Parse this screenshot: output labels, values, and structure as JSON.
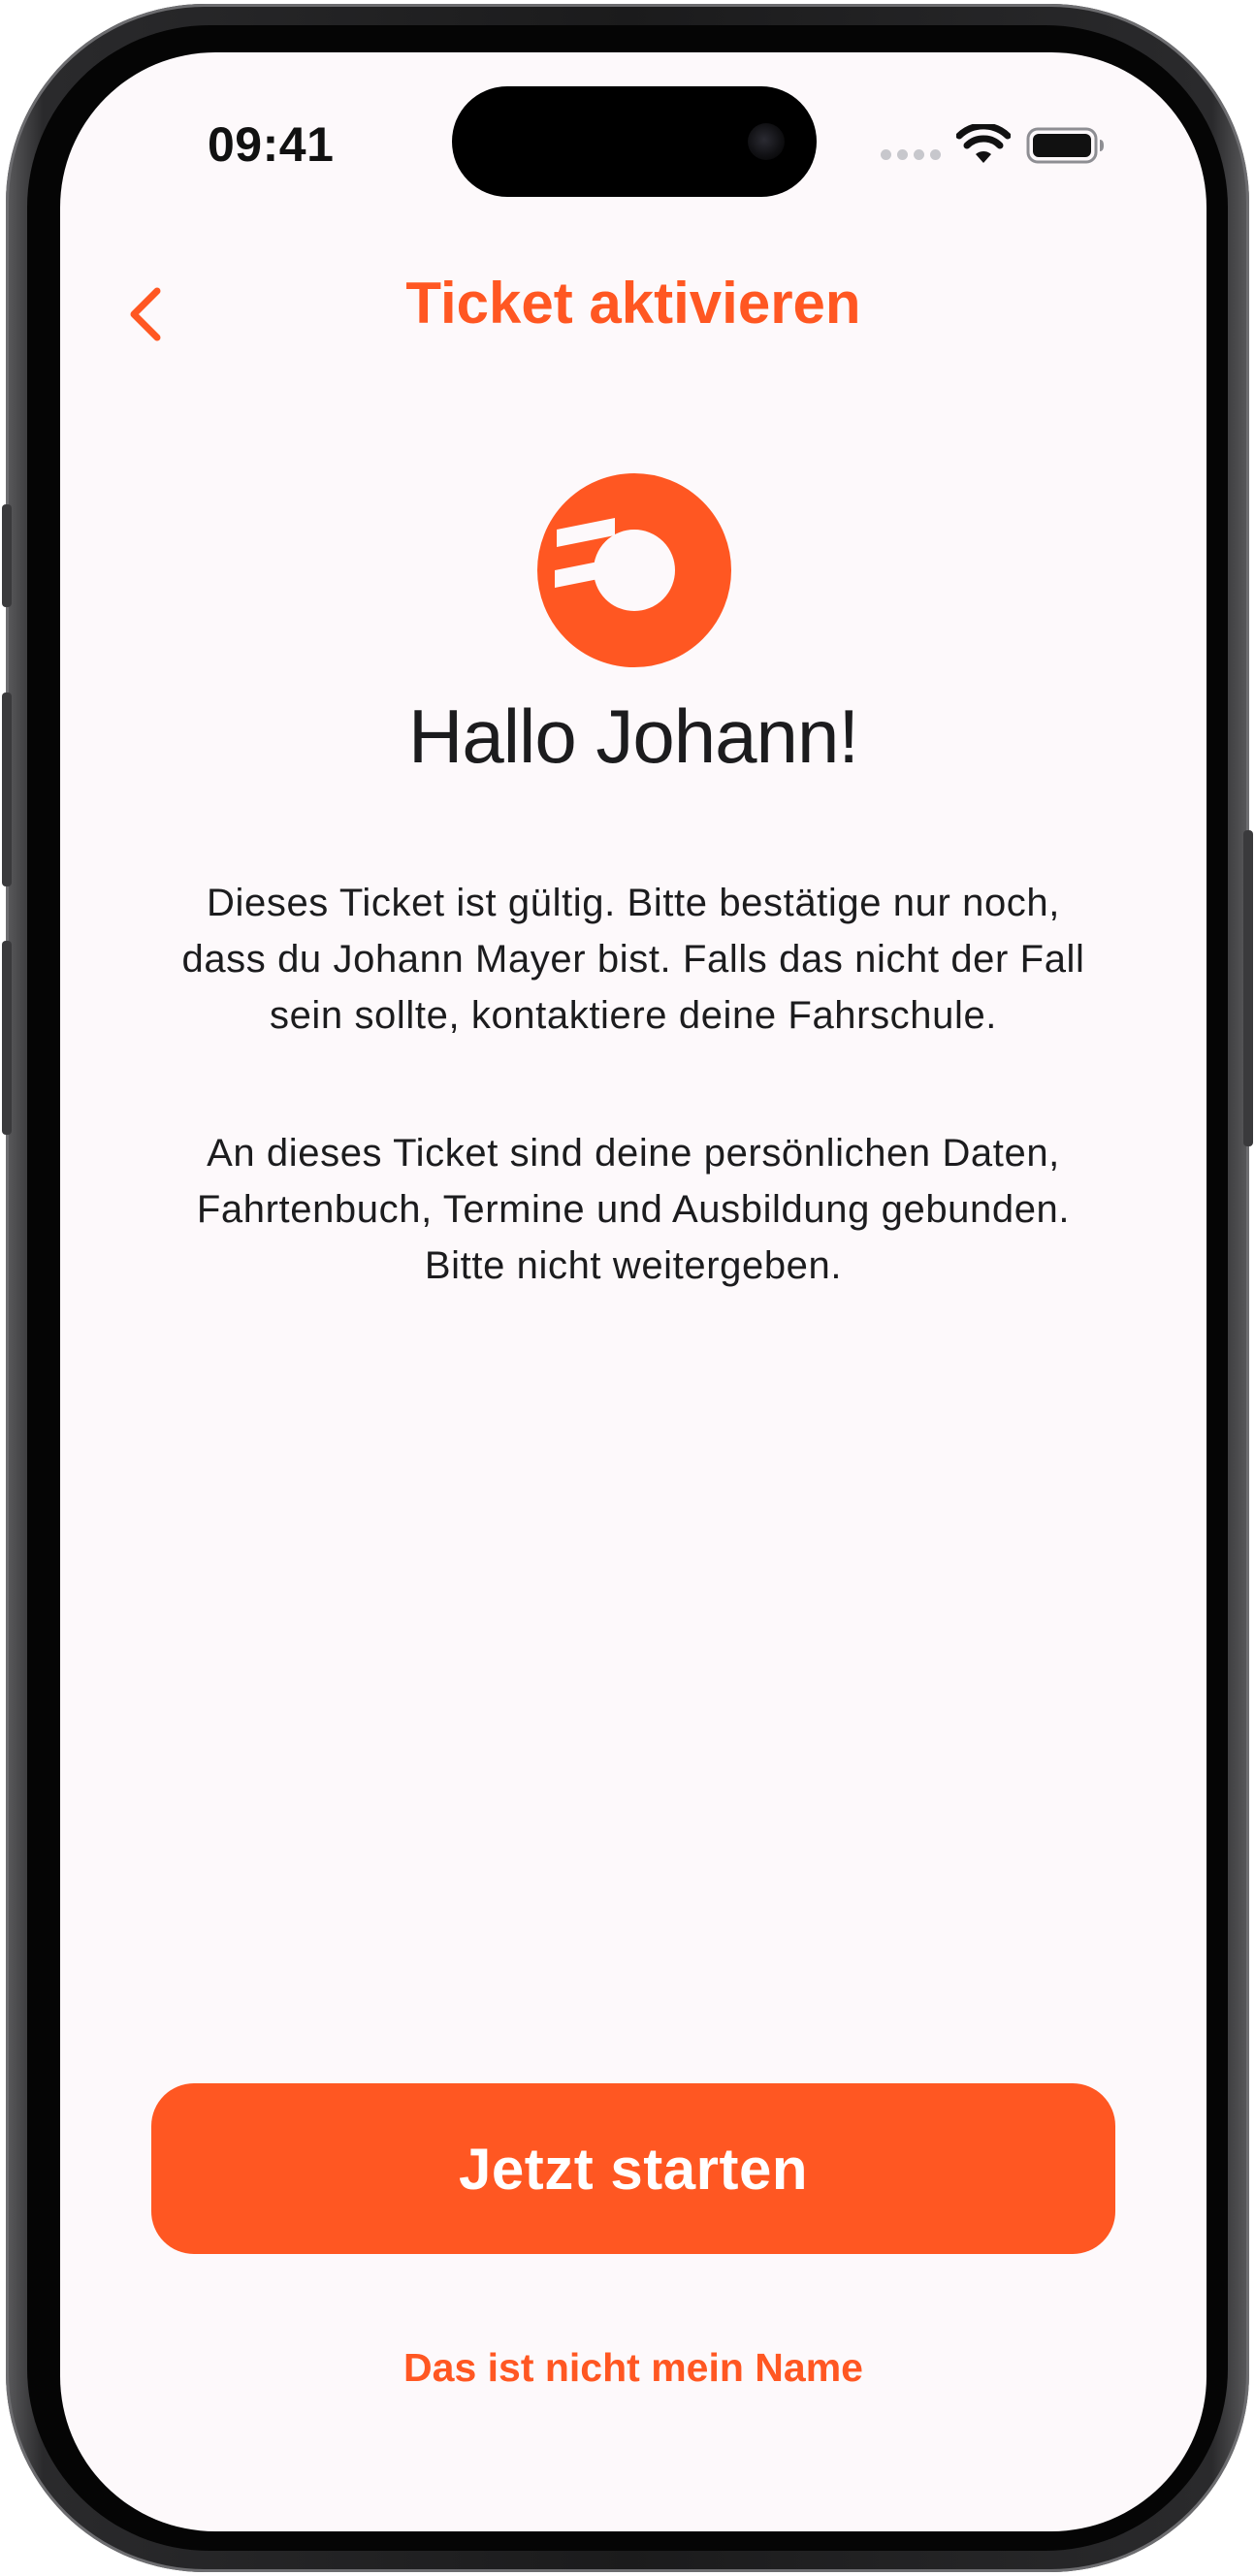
{
  "status_bar": {
    "time": "09:41"
  },
  "nav": {
    "title": "Ticket aktivieren",
    "back_icon": "chevron-left-icon"
  },
  "colors": {
    "accent": "#ff5722",
    "background": "#fdf9fb",
    "text": "#1c1c1e"
  },
  "main": {
    "logo_icon": "brand-logo-icon",
    "greeting": "Hallo Johann!",
    "paragraph_1": "Dieses Ticket ist gültig. Bitte bestätige nur noch, dass du Johann Mayer bist. Falls das nicht der Fall sein sollte, kontaktiere deine Fahrschule.",
    "paragraph_2": "An dieses Ticket sind deine persönlichen Daten, Fahrtenbuch, Termine und Ausbildung gebunden. Bitte nicht weitergeben."
  },
  "actions": {
    "start_label": "Jetzt starten",
    "not_my_name_label": "Das ist nicht mein Name"
  }
}
